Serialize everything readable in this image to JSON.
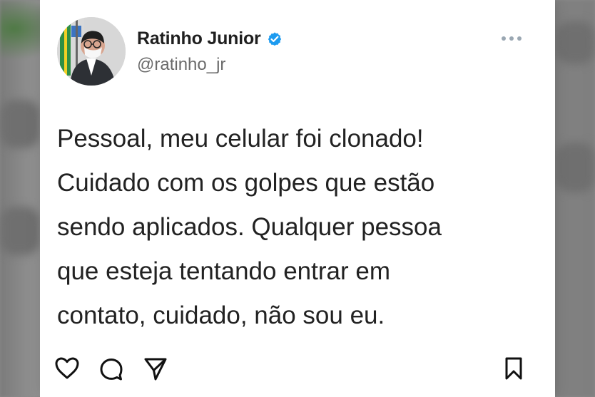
{
  "post": {
    "author": {
      "display_name": "Ratinho Junior",
      "handle": "@ratinho_jr",
      "verified": true,
      "verified_icon": "verified-badge-icon",
      "avatar_icon": "avatar-icon"
    },
    "text": "Pessoal, meu celular foi clonado!\nCuidado com os golpes que estão\nsendo aplicados. Qualquer pessoa\nque esteja tentando entrar em\ncontato, cuidado, não sou eu.",
    "actions": {
      "like": "heart-icon",
      "comment": "comment-icon",
      "share": "send-icon",
      "save": "bookmark-icon",
      "more": "more-icon"
    }
  },
  "colors": {
    "background": "#ffffff",
    "text_primary": "#222222",
    "text_secondary": "#6a6a6a",
    "verified_blue": "#1d9bf0",
    "more_gray": "#9aa7b2"
  }
}
